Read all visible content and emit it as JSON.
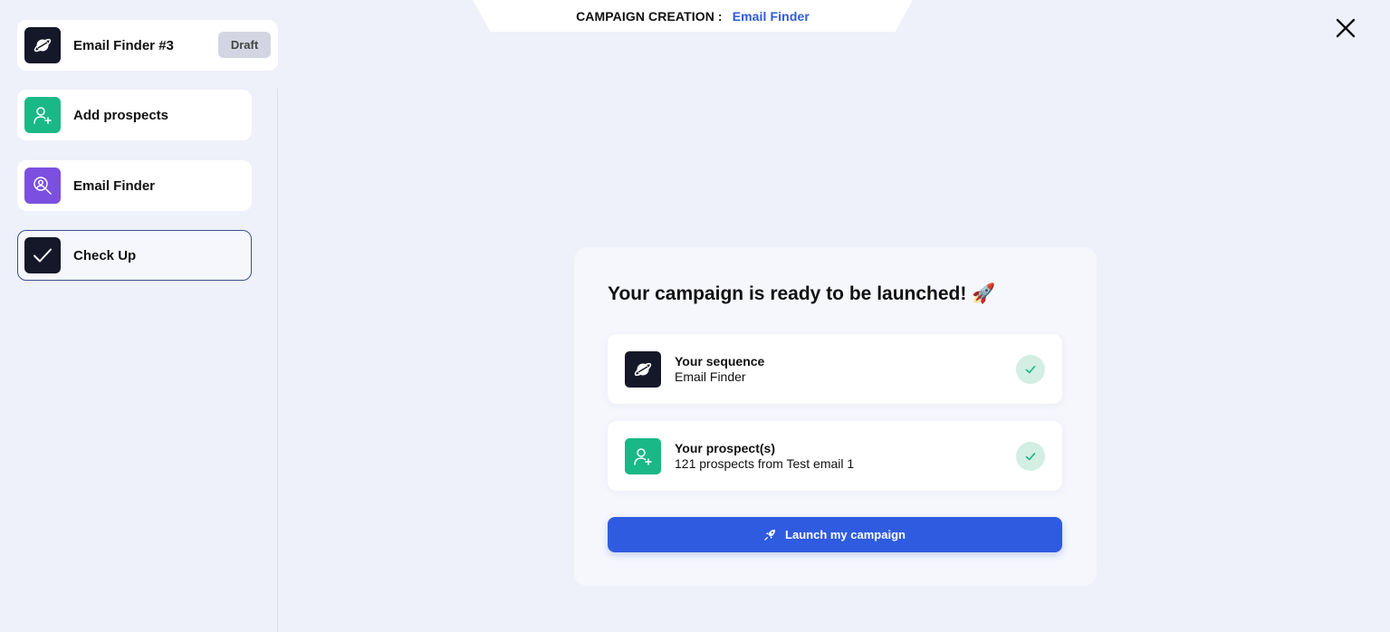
{
  "header": {
    "prefix": "CAMPAIGN CREATION :",
    "value": "Email Finder"
  },
  "sidebar": {
    "campaign": {
      "name": "Email Finder #3",
      "status": "Draft",
      "icon": "planet-icon",
      "color": "#151829"
    },
    "items": [
      {
        "label": "Add prospects",
        "icon": "user-plus-icon",
        "color": "#1ab887"
      },
      {
        "label": "Email Finder",
        "icon": "search-user-icon",
        "color": "#7b50e0"
      },
      {
        "label": "Check Up",
        "icon": "check-icon",
        "color": "#151829",
        "active": true
      }
    ]
  },
  "main": {
    "title": "Your campaign is ready to be launched! 🚀",
    "checks": [
      {
        "title": "Your sequence",
        "subtitle": "Email Finder",
        "icon": "planet-icon",
        "color": "#151829",
        "status": "check-icon"
      },
      {
        "title": "Your prospect(s)",
        "subtitle": "121 prospects from Test email 1",
        "icon": "user-plus-icon",
        "color": "#1ab887",
        "status": "check-icon"
      }
    ],
    "launch_label": "Launch my campaign"
  },
  "colors": {
    "accent": "#2f5be0",
    "background": "#eef0fa"
  }
}
